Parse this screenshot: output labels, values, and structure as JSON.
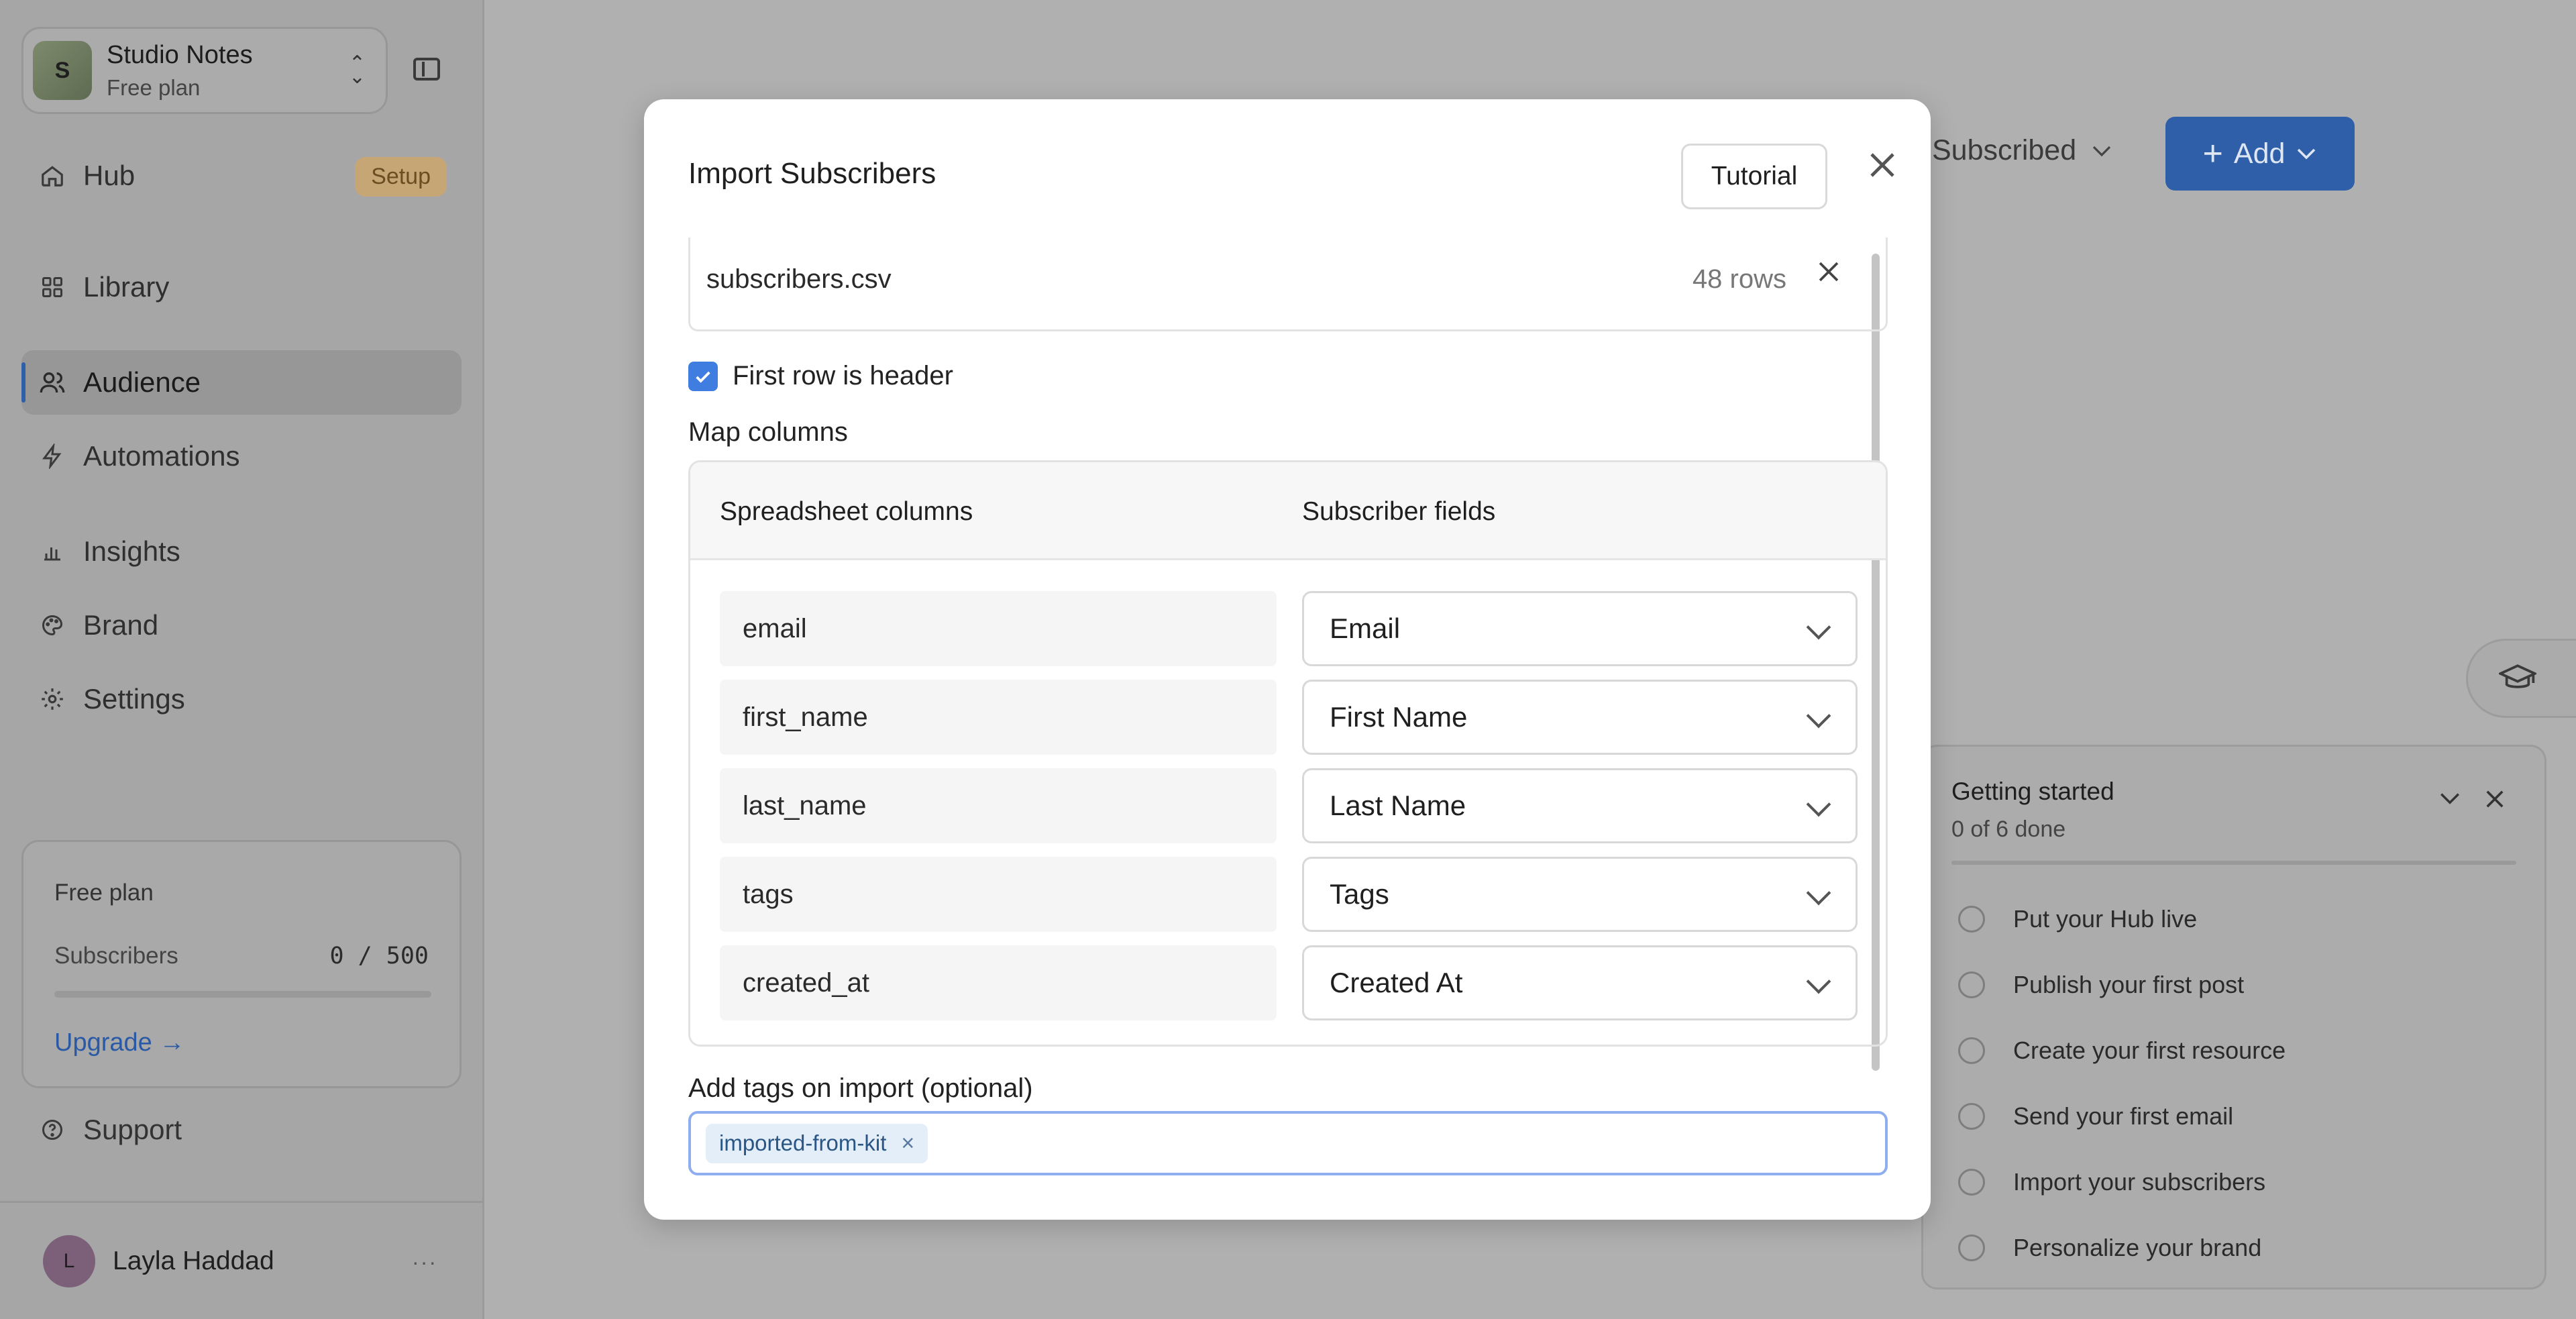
{
  "sidebar": {
    "workspace": {
      "avatar_initial": "S",
      "name": "Studio Notes",
      "plan": "Free plan"
    },
    "nav": [
      {
        "label": "Hub",
        "icon": "home-icon",
        "badge": "Setup"
      },
      {
        "label": "Library",
        "icon": "grid-icon"
      },
      {
        "label": "Audience",
        "icon": "users-icon",
        "active": true
      },
      {
        "label": "Automations",
        "icon": "bolt-icon"
      },
      {
        "label": "Insights",
        "icon": "bar-chart-icon"
      },
      {
        "label": "Brand",
        "icon": "palette-icon"
      },
      {
        "label": "Settings",
        "icon": "gear-icon"
      }
    ],
    "plan_card": {
      "title": "Free plan",
      "subscribers_label": "Subscribers",
      "subscribers_count": "0 / 500",
      "usage_fraction": 0.0,
      "upgrade_label": "Upgrade →"
    },
    "support_label": "Support",
    "user": {
      "avatar_initial": "L",
      "name": "Layla Haddad",
      "more": "···"
    }
  },
  "background": {
    "filter_label": "Subscribed",
    "add_label": "Add"
  },
  "getting_started": {
    "title": "Getting started",
    "progress": "0 of 6 done",
    "items": [
      "Put your Hub live",
      "Publish your first post",
      "Create your first resource",
      "Send your first email",
      "Import your subscribers",
      "Personalize your brand"
    ]
  },
  "modal": {
    "title": "Import Subscribers",
    "tutorial_label": "Tutorial",
    "file": {
      "name": "subscribers.csv",
      "rows": "48 rows"
    },
    "header_checkbox": {
      "label": "First row is header",
      "checked": true
    },
    "map_columns_label": "Map columns",
    "table_headers": {
      "source": "Spreadsheet columns",
      "target": "Subscriber fields"
    },
    "mappings": [
      {
        "source": "email",
        "field": "Email"
      },
      {
        "source": "first_name",
        "field": "First Name"
      },
      {
        "source": "last_name",
        "field": "Last Name"
      },
      {
        "source": "tags",
        "field": "Tags"
      },
      {
        "source": "created_at",
        "field": "Created At"
      }
    ],
    "tags_label": "Add tags on import (optional)",
    "tags": [
      "imported-from-kit"
    ]
  },
  "colors": {
    "accent": "#3f7ee0",
    "nav_active_indicator": "#2f5fa8",
    "setup_badge": "#c7a676"
  }
}
